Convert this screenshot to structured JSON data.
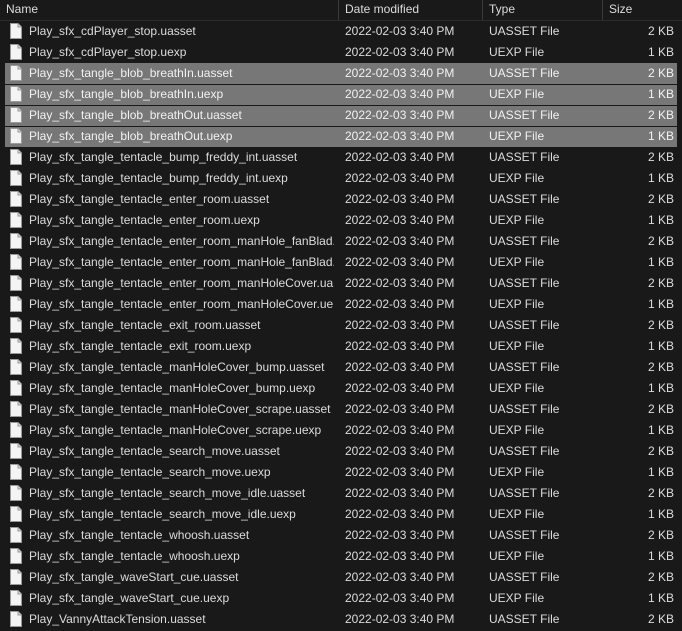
{
  "columns": {
    "name": "Name",
    "date": "Date modified",
    "type": "Type",
    "size": "Size"
  },
  "files": [
    {
      "name": "Play_sfx_cdPlayer_stop.uasset",
      "date": "2022-02-03 3:40 PM",
      "type": "UASSET File",
      "size": "2 KB",
      "selected": false
    },
    {
      "name": "Play_sfx_cdPlayer_stop.uexp",
      "date": "2022-02-03 3:40 PM",
      "type": "UEXP File",
      "size": "1 KB",
      "selected": false
    },
    {
      "name": "Play_sfx_tangle_blob_breathIn.uasset",
      "date": "2022-02-03 3:40 PM",
      "type": "UASSET File",
      "size": "2 KB",
      "selected": true
    },
    {
      "name": "Play_sfx_tangle_blob_breathIn.uexp",
      "date": "2022-02-03 3:40 PM",
      "type": "UEXP File",
      "size": "1 KB",
      "selected": true
    },
    {
      "name": "Play_sfx_tangle_blob_breathOut.uasset",
      "date": "2022-02-03 3:40 PM",
      "type": "UASSET File",
      "size": "2 KB",
      "selected": true
    },
    {
      "name": "Play_sfx_tangle_blob_breathOut.uexp",
      "date": "2022-02-03 3:40 PM",
      "type": "UEXP File",
      "size": "1 KB",
      "selected": true
    },
    {
      "name": "Play_sfx_tangle_tentacle_bump_freddy_int.uasset",
      "date": "2022-02-03 3:40 PM",
      "type": "UASSET File",
      "size": "2 KB",
      "selected": false
    },
    {
      "name": "Play_sfx_tangle_tentacle_bump_freddy_int.uexp",
      "date": "2022-02-03 3:40 PM",
      "type": "UEXP File",
      "size": "1 KB",
      "selected": false
    },
    {
      "name": "Play_sfx_tangle_tentacle_enter_room.uasset",
      "date": "2022-02-03 3:40 PM",
      "type": "UASSET File",
      "size": "2 KB",
      "selected": false
    },
    {
      "name": "Play_sfx_tangle_tentacle_enter_room.uexp",
      "date": "2022-02-03 3:40 PM",
      "type": "UEXP File",
      "size": "1 KB",
      "selected": false
    },
    {
      "name": "Play_sfx_tangle_tentacle_enter_room_manHole_fanBlad...",
      "date": "2022-02-03 3:40 PM",
      "type": "UASSET File",
      "size": "2 KB",
      "selected": false
    },
    {
      "name": "Play_sfx_tangle_tentacle_enter_room_manHole_fanBlad...",
      "date": "2022-02-03 3:40 PM",
      "type": "UEXP File",
      "size": "1 KB",
      "selected": false
    },
    {
      "name": "Play_sfx_tangle_tentacle_enter_room_manHoleCover.ua...",
      "date": "2022-02-03 3:40 PM",
      "type": "UASSET File",
      "size": "2 KB",
      "selected": false
    },
    {
      "name": "Play_sfx_tangle_tentacle_enter_room_manHoleCover.ue...",
      "date": "2022-02-03 3:40 PM",
      "type": "UEXP File",
      "size": "1 KB",
      "selected": false
    },
    {
      "name": "Play_sfx_tangle_tentacle_exit_room.uasset",
      "date": "2022-02-03 3:40 PM",
      "type": "UASSET File",
      "size": "2 KB",
      "selected": false
    },
    {
      "name": "Play_sfx_tangle_tentacle_exit_room.uexp",
      "date": "2022-02-03 3:40 PM",
      "type": "UEXP File",
      "size": "1 KB",
      "selected": false
    },
    {
      "name": "Play_sfx_tangle_tentacle_manHoleCover_bump.uasset",
      "date": "2022-02-03 3:40 PM",
      "type": "UASSET File",
      "size": "2 KB",
      "selected": false
    },
    {
      "name": "Play_sfx_tangle_tentacle_manHoleCover_bump.uexp",
      "date": "2022-02-03 3:40 PM",
      "type": "UEXP File",
      "size": "1 KB",
      "selected": false
    },
    {
      "name": "Play_sfx_tangle_tentacle_manHoleCover_scrape.uasset",
      "date": "2022-02-03 3:40 PM",
      "type": "UASSET File",
      "size": "2 KB",
      "selected": false
    },
    {
      "name": "Play_sfx_tangle_tentacle_manHoleCover_scrape.uexp",
      "date": "2022-02-03 3:40 PM",
      "type": "UEXP File",
      "size": "1 KB",
      "selected": false
    },
    {
      "name": "Play_sfx_tangle_tentacle_search_move.uasset",
      "date": "2022-02-03 3:40 PM",
      "type": "UASSET File",
      "size": "2 KB",
      "selected": false
    },
    {
      "name": "Play_sfx_tangle_tentacle_search_move.uexp",
      "date": "2022-02-03 3:40 PM",
      "type": "UEXP File",
      "size": "1 KB",
      "selected": false
    },
    {
      "name": "Play_sfx_tangle_tentacle_search_move_idle.uasset",
      "date": "2022-02-03 3:40 PM",
      "type": "UASSET File",
      "size": "2 KB",
      "selected": false
    },
    {
      "name": "Play_sfx_tangle_tentacle_search_move_idle.uexp",
      "date": "2022-02-03 3:40 PM",
      "type": "UEXP File",
      "size": "1 KB",
      "selected": false
    },
    {
      "name": "Play_sfx_tangle_tentacle_whoosh.uasset",
      "date": "2022-02-03 3:40 PM",
      "type": "UASSET File",
      "size": "2 KB",
      "selected": false
    },
    {
      "name": "Play_sfx_tangle_tentacle_whoosh.uexp",
      "date": "2022-02-03 3:40 PM",
      "type": "UEXP File",
      "size": "1 KB",
      "selected": false
    },
    {
      "name": "Play_sfx_tangle_waveStart_cue.uasset",
      "date": "2022-02-03 3:40 PM",
      "type": "UASSET File",
      "size": "2 KB",
      "selected": false
    },
    {
      "name": "Play_sfx_tangle_waveStart_cue.uexp",
      "date": "2022-02-03 3:40 PM",
      "type": "UEXP File",
      "size": "1 KB",
      "selected": false
    },
    {
      "name": "Play_VannyAttackTension.uasset",
      "date": "2022-02-03 3:40 PM",
      "type": "UASSET File",
      "size": "2 KB",
      "selected": false
    }
  ],
  "icons": {
    "file": "file-icon"
  },
  "colors": {
    "background": "#191919",
    "selection": "#777777",
    "text": "#dcdcdc"
  }
}
